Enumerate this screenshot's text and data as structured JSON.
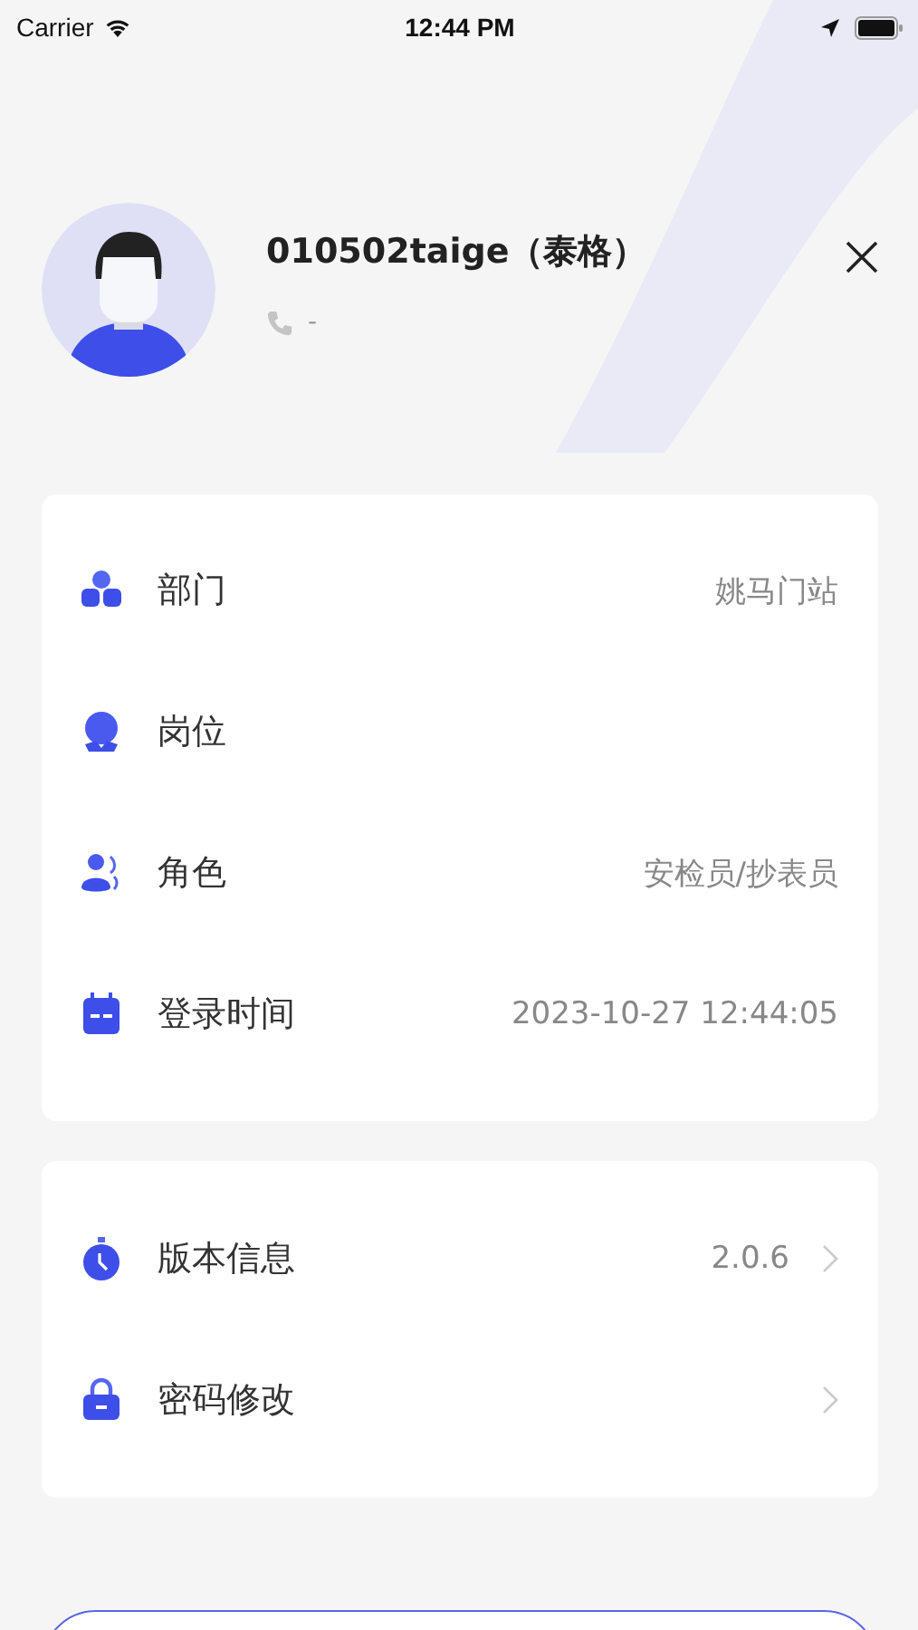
{
  "status_bar": {
    "carrier": "Carrier",
    "time": "12:44 PM"
  },
  "profile": {
    "name": "010502taige（泰格）",
    "phone": "-"
  },
  "info_card": [
    {
      "kind": "department",
      "label": "部门",
      "value": "姚马门站"
    },
    {
      "kind": "position",
      "label": "岗位"
    },
    {
      "kind": "role",
      "label": "角色",
      "value": "安检员/抄表员"
    },
    {
      "kind": "calendar",
      "label": "登录时间",
      "value": "2023-10-27 12:44:05"
    }
  ],
  "settings_card": [
    {
      "kind": "timer",
      "label": "版本信息",
      "value": "2.0.6"
    },
    {
      "kind": "lock",
      "label": "密码修改"
    }
  ]
}
